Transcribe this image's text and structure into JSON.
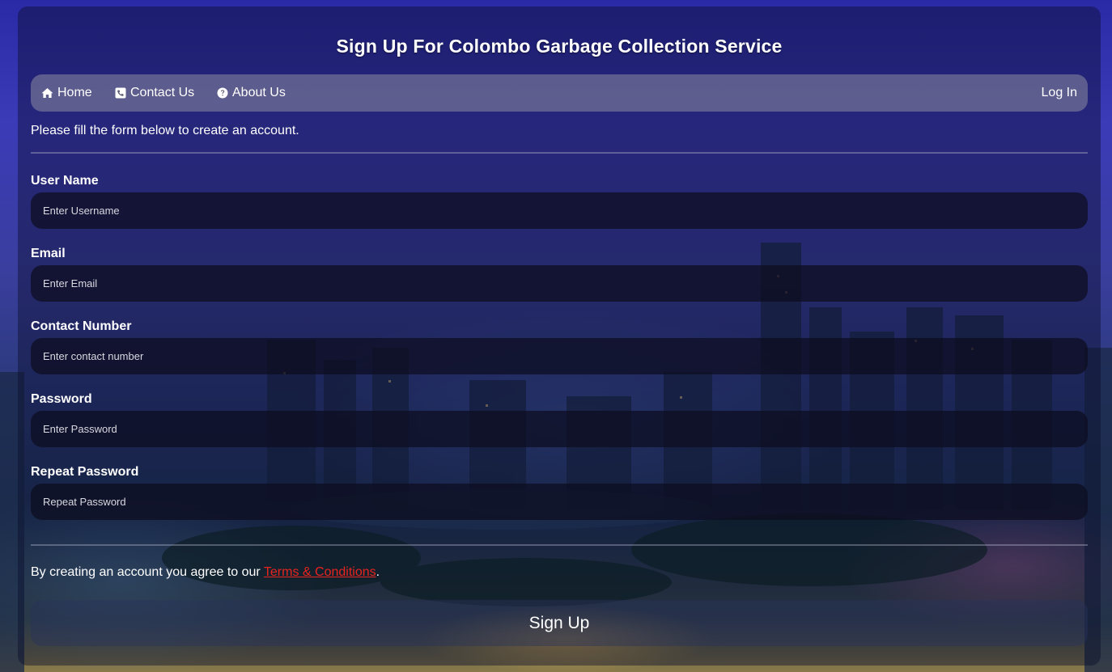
{
  "page": {
    "title": "Sign Up For Colombo Garbage Collection Service"
  },
  "nav": {
    "home": {
      "label": "Home",
      "icon": "home-icon"
    },
    "contact": {
      "label": "Contact Us",
      "icon": "phone-square-icon"
    },
    "about": {
      "label": "About Us",
      "icon": "question-circle-icon"
    },
    "login": {
      "label": "Log In"
    }
  },
  "form": {
    "intro": "Please fill the form below to create an account.",
    "username": {
      "label": "User Name",
      "placeholder": "Enter Username"
    },
    "email": {
      "label": "Email",
      "placeholder": "Enter Email"
    },
    "contact": {
      "label": "Contact Number",
      "placeholder": "Enter contact number"
    },
    "password": {
      "label": "Password",
      "placeholder": "Enter Password"
    },
    "repeat_password": {
      "label": "Repeat Password",
      "placeholder": "Repeat Password"
    },
    "terms_prefix": "By creating an account you agree to our ",
    "terms_link": "Terms & Conditions",
    "terms_suffix": ".",
    "submit_label": "Sign Up"
  },
  "colors": {
    "terms_link": "#e8241e",
    "panel_overlay": "rgba(10,12,40,0.42)"
  }
}
